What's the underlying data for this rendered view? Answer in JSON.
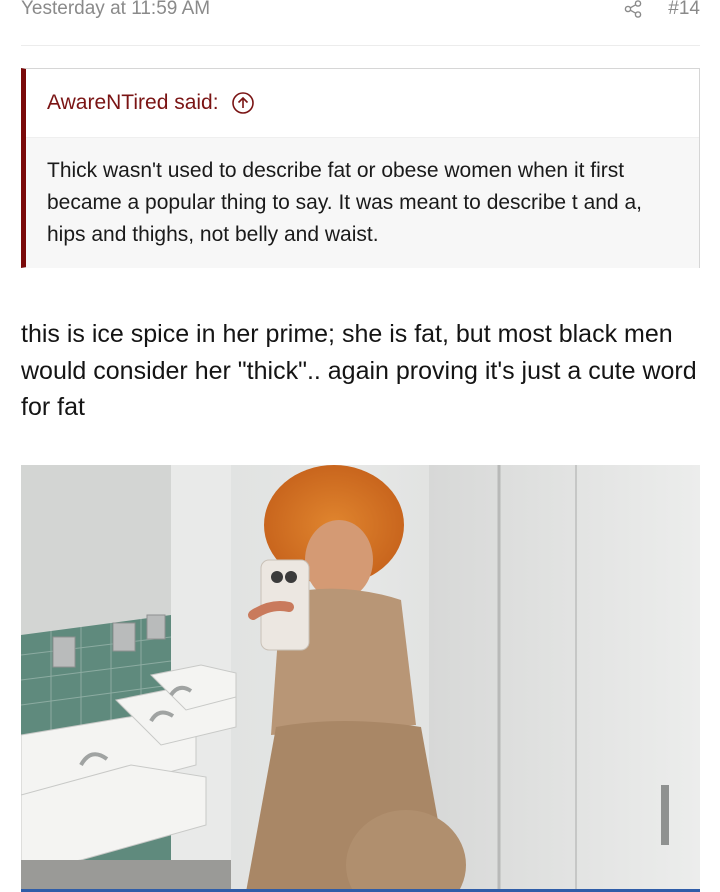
{
  "post": {
    "timestamp": "Yesterday at 11:59 AM",
    "number": "#14",
    "text": "this is ice spice in her prime; she is fat, but most black men would consider her \"thick\".. again proving it's just a cute word for fat"
  },
  "quote": {
    "author_label": "AwareNTired said:",
    "body": "Thick wasn't used to describe fat or obese women when it first became a popular thing to say. It was meant to describe t and a, hips and thighs, not belly and waist."
  },
  "icons": {
    "share": "share-icon",
    "jump": "arrow-up-circle-icon"
  },
  "colors": {
    "quote_accent": "#7a0a0a",
    "quote_author": "#7a1414",
    "muted": "#8a8a8a"
  }
}
